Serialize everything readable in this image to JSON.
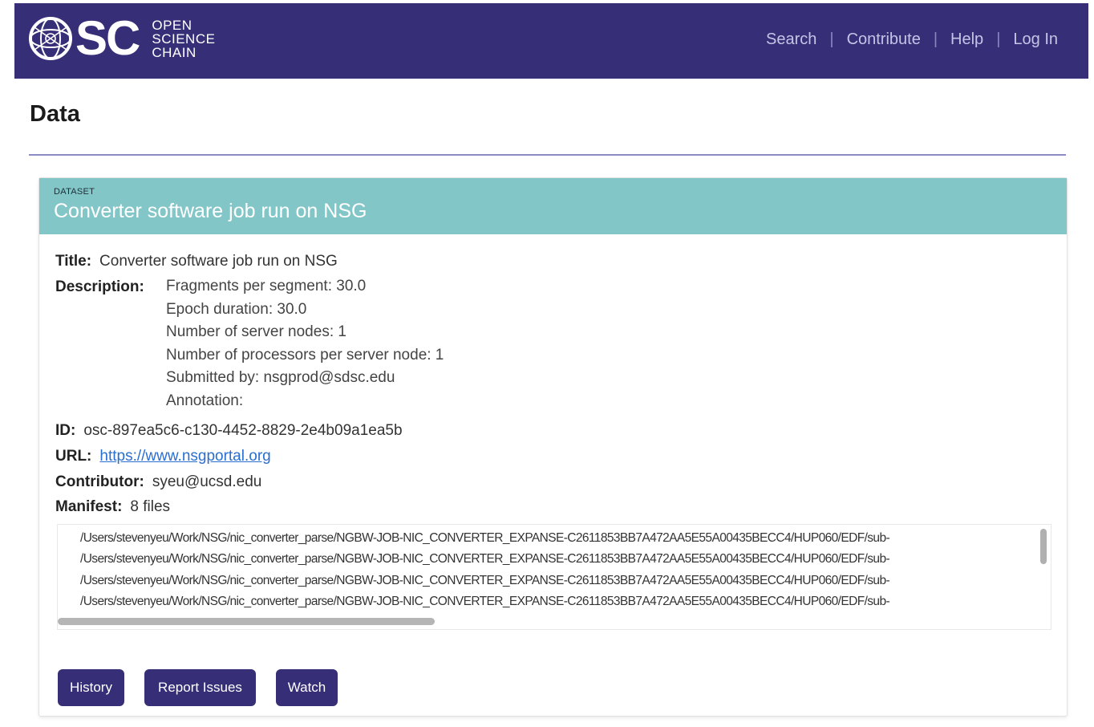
{
  "header": {
    "logo_letters": "SC",
    "logo_text_lines": [
      "OPEN",
      "SCIENCE",
      "CHAIN"
    ],
    "nav": [
      "Search",
      "Contribute",
      "Help",
      "Log In"
    ],
    "background_color": "#362f77"
  },
  "page_title": "Data",
  "dataset": {
    "kicker": "DATASET",
    "heading": "Converter software job run on NSG",
    "title_label": "Title:",
    "title_value": "Converter software job run on NSG",
    "description_label": "Description:",
    "description_lines": [
      "Fragments per segment: 30.0",
      "Epoch duration: 30.0",
      "Number of server nodes: 1",
      "Number of processors per server node: 1",
      "Submitted by: nsgprod@sdsc.edu",
      "Annotation:"
    ],
    "id_label": "ID:",
    "id_value": "osc-897ea5c6-c130-4452-8829-2e4b09a1ea5b",
    "url_label": "URL:",
    "url_value": "https://www.nsgportal.org",
    "contributor_label": "Contributor:",
    "contributor_value": "syeu@ucsd.edu",
    "manifest_label": "Manifest:",
    "manifest_count": "8 files",
    "manifest_lines": [
      "/Users/stevenyeu/Work/NSG/nic_converter_parse/NGBW-JOB-NIC_CONVERTER_EXPANSE-C2611853BB7A472AA5E55A00435BECC4/HUP060/EDF/sub-",
      "/Users/stevenyeu/Work/NSG/nic_converter_parse/NGBW-JOB-NIC_CONVERTER_EXPANSE-C2611853BB7A472AA5E55A00435BECC4/HUP060/EDF/sub-",
      "/Users/stevenyeu/Work/NSG/nic_converter_parse/NGBW-JOB-NIC_CONVERTER_EXPANSE-C2611853BB7A472AA5E55A00435BECC4/HUP060/EDF/sub-",
      "/Users/stevenyeu/Work/NSG/nic_converter_parse/NGBW-JOB-NIC_CONVERTER_EXPANSE-C2611853BB7A472AA5E55A00435BECC4/HUP060/EDF/sub-"
    ]
  },
  "buttons": {
    "history": "History",
    "report_issues": "Report Issues",
    "watch": "Watch"
  },
  "colors": {
    "brand": "#362f77",
    "card_header": "#83c6c8",
    "link": "#2a6fd0"
  }
}
